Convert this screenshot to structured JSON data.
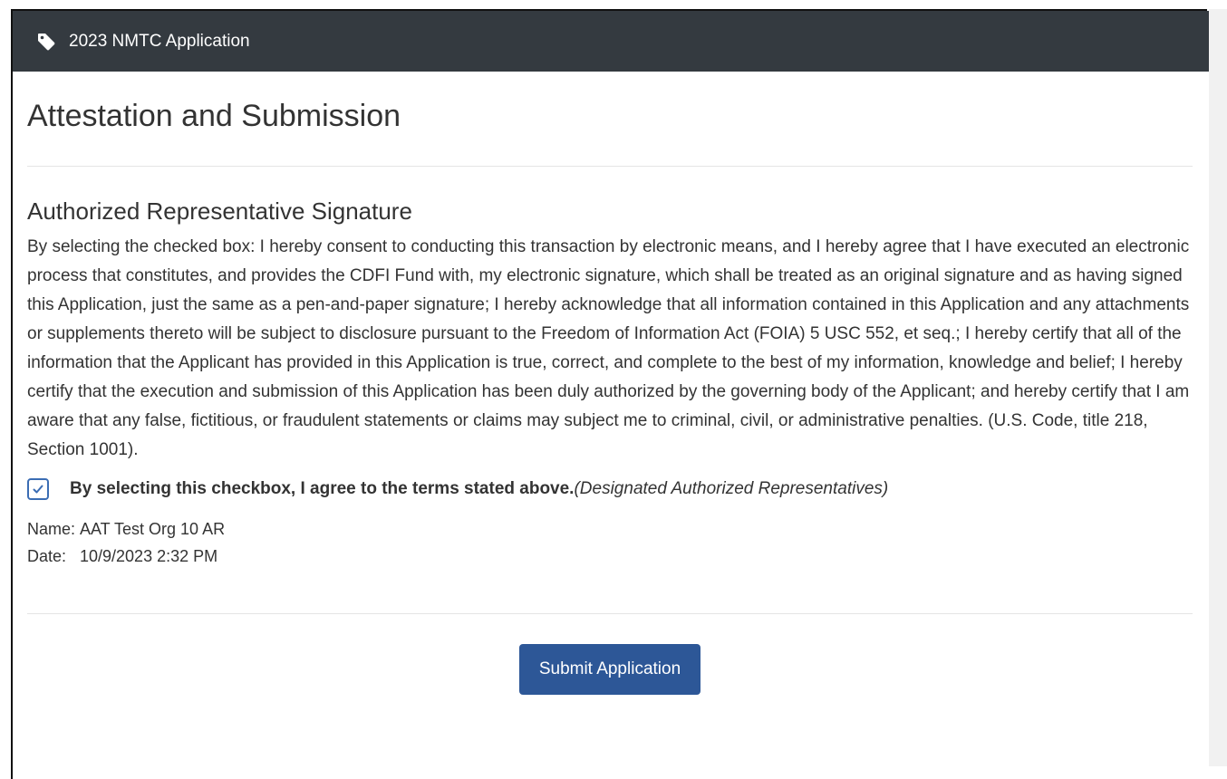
{
  "header": {
    "icon": "tag-icon",
    "title": "2023 NMTC Application"
  },
  "page": {
    "title": "Attestation and Submission"
  },
  "signature": {
    "section_title": "Authorized Representative Signature",
    "body": "By selecting the checked box: I hereby consent to conducting this transaction by electronic means, and I hereby agree that I have executed an electronic process that constitutes, and provides the CDFI Fund with, my electronic signature, which shall be treated as an original signature and as having signed this Application, just the same as a pen-and-paper signature; I hereby acknowledge that all information contained in this Application and any attachments or supplements thereto will be subject to disclosure pursuant to the Freedom of Information Act (FOIA) 5 USC 552, et seq.; I hereby certify that all of the information that the Applicant has provided in this Application is true, correct, and complete to the best of my information, knowledge and belief; I hereby certify that the execution and submission of this Application has been duly authorized by the governing body of the Applicant; and hereby certify that I am aware that any false, fictitious, or fraudulent statements or claims may subject me to criminal, civil, or administrative penalties. (U.S. Code, title 218, Section 1001).",
    "checkbox_checked": true,
    "agree_bold": "By selecting this checkbox, I agree to the terms stated above.",
    "agree_italic": "(Designated Authorized Representatives)",
    "name_label": "Name:",
    "name_value": "AAT Test Org 10 AR",
    "date_label": "Date:",
    "date_value": "10/9/2023 2:32 PM"
  },
  "actions": {
    "submit_label": "Submit Application"
  },
  "colors": {
    "header_bg": "#343a40",
    "button_bg": "#2d5797",
    "checkbox_border": "#3b6db4"
  }
}
